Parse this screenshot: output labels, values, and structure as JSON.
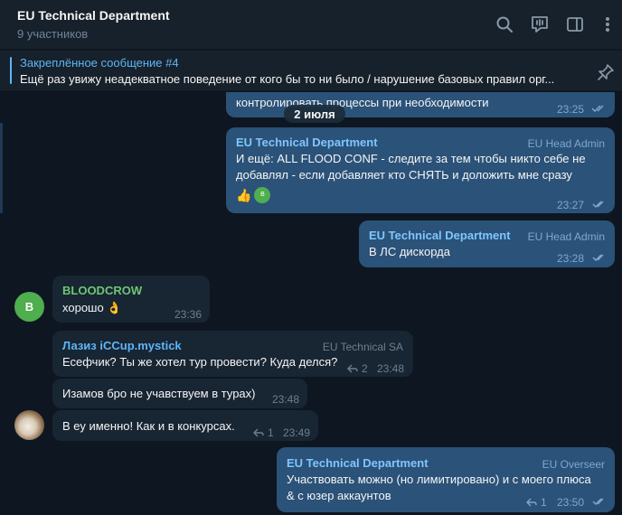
{
  "header": {
    "title": "EU Technical Department",
    "subtitle": "9 участников"
  },
  "pinned": {
    "title": "Закреплённое сообщение #4",
    "text": "Ещё раз увижу неадекватное поведение от кого бы то ни было / нарушение базовых правил орг..."
  },
  "messages": {
    "m0": {
      "text": "контролировать процессы при необходимости",
      "time": "23:25"
    },
    "date_separator": "2 июля",
    "m1": {
      "sender": "EU Technical Department",
      "role": "EU Head Admin",
      "text": "И ещё: ALL FLOOD CONF - следите за тем чтобы никто себе не добавлял - если добавляет кто СНЯТЬ и доложить мне сразу",
      "reaction_emoji": "👍",
      "reaction_avatar": "B",
      "time": "23:27"
    },
    "m2": {
      "sender": "EU Technical Department",
      "role": "EU Head Admin",
      "text": "В ЛС дискорда",
      "time": "23:28"
    },
    "m3": {
      "avatar": "B",
      "sender": "BLOODCROW",
      "text": "хорошо 👌",
      "time": "23:36"
    },
    "m4": {
      "sender": "Лазиз iCCup.mystick",
      "role": "EU Technical SA",
      "text": "Есефчик? Ты же хотел тур провести? Куда делся?",
      "replies": "2",
      "time": "23:48"
    },
    "m5": {
      "text": "Изамов бро не учавствуем в турах)",
      "time": "23:48"
    },
    "m6": {
      "text": "В еу именно! Как и в конкурсах.",
      "replies": "1",
      "time": "23:49"
    },
    "m7": {
      "sender": "EU Technical Department",
      "role": "EU Overseer",
      "text": "Участвовать можно (но лимитировано) и с моего плюса & с юзер аккаунтов",
      "replies": "1",
      "time": "23:50"
    }
  },
  "colors": {
    "background": "#0e1621",
    "panel": "#17212b",
    "outgoing_bubble": "#2b5278",
    "incoming_bubble": "#182533",
    "accent": "#5eb5f7",
    "avatar_green": "#4fae4e"
  },
  "icons": [
    "search-icon",
    "voice-chat-icon",
    "sidebar-toggle-icon",
    "more-icon",
    "pin-icon",
    "reply-icon",
    "read-checks-icon"
  ]
}
